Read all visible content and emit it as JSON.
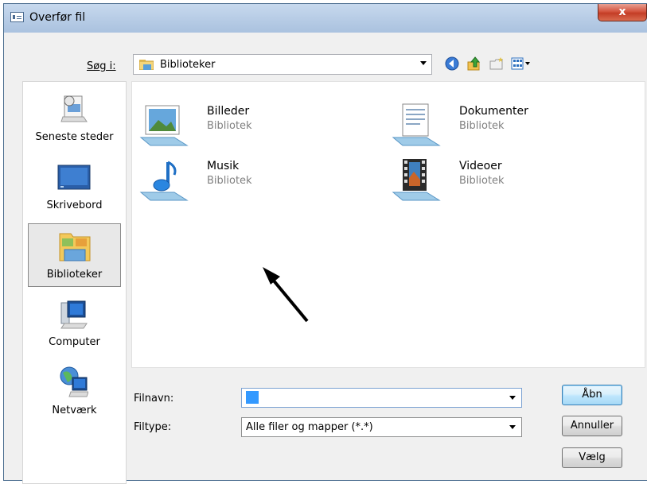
{
  "window": {
    "title": "Overfør fil",
    "close_glyph": "x"
  },
  "lookin": {
    "label": "Søg i:",
    "value": "Biblioteker",
    "icon": "libraries-folder-icon"
  },
  "toolbar": {
    "icons": [
      "back-icon",
      "up-folder-icon",
      "new-folder-icon",
      "view-menu-icon"
    ]
  },
  "places": [
    {
      "label": "Seneste steder",
      "icon": "recent-places-icon",
      "selected": false
    },
    {
      "label": "Skrivebord",
      "icon": "desktop-icon",
      "selected": false
    },
    {
      "label": "Biblioteker",
      "icon": "libraries-icon",
      "selected": true
    },
    {
      "label": "Computer",
      "icon": "computer-icon",
      "selected": false
    },
    {
      "label": "Netværk",
      "icon": "network-icon",
      "selected": false
    }
  ],
  "libraries": [
    {
      "name": "Billeder",
      "type": "Bibliotek",
      "icon": "pictures-library-icon"
    },
    {
      "name": "Dokumenter",
      "type": "Bibliotek",
      "icon": "documents-library-icon"
    },
    {
      "name": "Musik",
      "type": "Bibliotek",
      "icon": "music-library-icon"
    },
    {
      "name": "Videoer",
      "type": "Bibliotek",
      "icon": "videos-library-icon"
    }
  ],
  "filename": {
    "label": "Filnavn:",
    "value": ""
  },
  "filetype": {
    "label": "Filtype:",
    "value": "Alle filer og mapper (*.*)"
  },
  "buttons": {
    "open": "Åbn",
    "cancel": "Annuller",
    "select": "Vælg"
  }
}
